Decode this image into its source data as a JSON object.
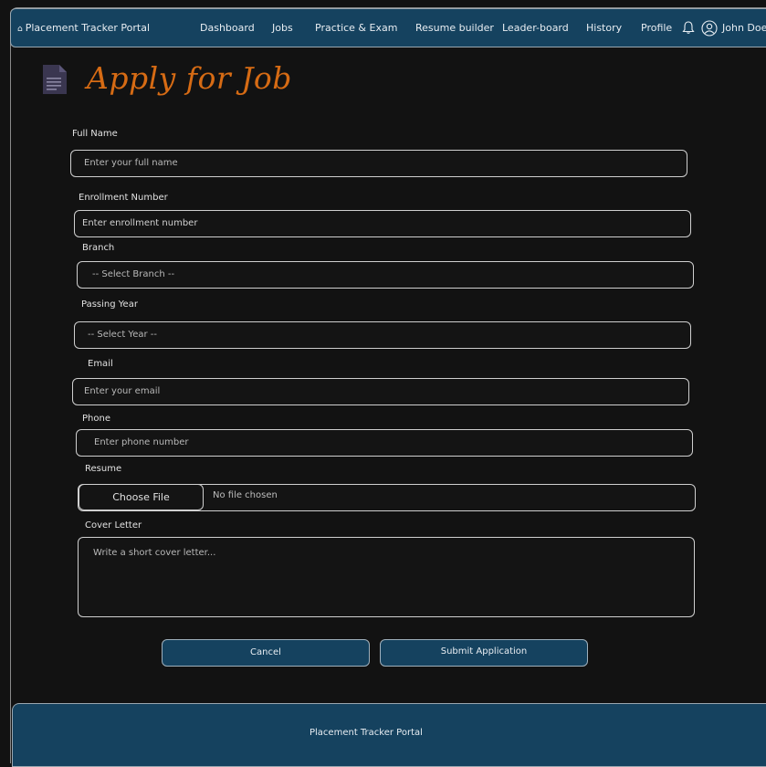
{
  "nav": {
    "brand": "Placement Tracker Portal",
    "items": [
      "Dashboard",
      "Jobs",
      "Practice & Exam",
      "Resume builder",
      "Leader-board",
      "History",
      "Profile"
    ],
    "user": "John Doe"
  },
  "page": {
    "title": "Apply for Job"
  },
  "form": {
    "full_name": {
      "label": "Full Name",
      "placeholder": "Enter your full name"
    },
    "enrollment": {
      "label": "Enrollment Number",
      "placeholder": "Enter enrollment number"
    },
    "branch": {
      "label": "Branch",
      "value": "-- Select Branch --"
    },
    "passing_year": {
      "label": "Passing Year",
      "value": "-- Select Year --"
    },
    "email": {
      "label": "Email",
      "placeholder": "Enter your email"
    },
    "phone": {
      "label": "Phone",
      "placeholder": "Enter phone number"
    },
    "resume": {
      "label": "Resume",
      "button": "Choose File",
      "status": "No file chosen"
    },
    "cover_letter": {
      "label": "Cover Letter",
      "placeholder": "Write a short cover letter..."
    },
    "cancel": "Cancel",
    "submit": "Submit Application"
  },
  "footer": {
    "text": "Placement Tracker Portal"
  },
  "colors": {
    "nav_bg": "#15425f",
    "title": "#d66b14",
    "page_bg": "#121212"
  },
  "icons": [
    "home-icon",
    "bell-icon",
    "user-icon",
    "document-icon"
  ]
}
